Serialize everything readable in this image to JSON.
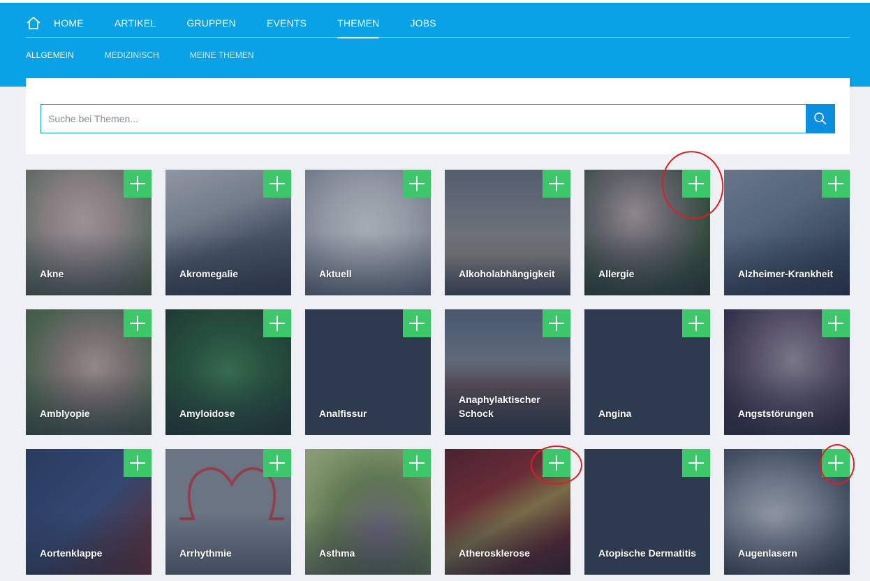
{
  "nav": {
    "home_icon": "home-icon",
    "items": [
      {
        "label": "HOME",
        "active": false
      },
      {
        "label": "ARTIKEL",
        "active": false
      },
      {
        "label": "GRUPPEN",
        "active": false
      },
      {
        "label": "EVENTS",
        "active": false
      },
      {
        "label": "THEMEN",
        "active": true
      },
      {
        "label": "JOBS",
        "active": false
      }
    ]
  },
  "subnav": {
    "items": [
      {
        "label": "ALLGEMEIN",
        "active": true
      },
      {
        "label": "MEDIZINISCH",
        "active": false
      },
      {
        "label": "MEINE THEMEN",
        "active": false
      }
    ]
  },
  "search": {
    "placeholder": "Suche bei Themen...",
    "value": "",
    "button_icon": "search-icon"
  },
  "colors": {
    "accent": "#0aa2e6",
    "add_button": "#3cc86a",
    "tile_dark": "#2e3a4e",
    "annotation": "#e01b22"
  },
  "topics": [
    {
      "label": "Akne",
      "has_image": true
    },
    {
      "label": "Akromegalie",
      "has_image": true
    },
    {
      "label": "Aktuell",
      "has_image": true
    },
    {
      "label": "Alkoholabhängigkeit",
      "has_image": true
    },
    {
      "label": "Allergie",
      "has_image": true
    },
    {
      "label": "Alzheimer-Krankheit",
      "has_image": true
    },
    {
      "label": "Amblyopie",
      "has_image": true
    },
    {
      "label": "Amyloidose",
      "has_image": true
    },
    {
      "label": "Analfissur",
      "has_image": false
    },
    {
      "label": "Anaphylaktischer Schock",
      "has_image": true
    },
    {
      "label": "Angina",
      "has_image": false
    },
    {
      "label": "Angststörungen",
      "has_image": true
    },
    {
      "label": "Aortenklappe",
      "has_image": true
    },
    {
      "label": "Arrhythmie",
      "has_image": true
    },
    {
      "label": "Asthma",
      "has_image": true
    },
    {
      "label": "Atherosklerose",
      "has_image": true
    },
    {
      "label": "Atopische Dermatitis",
      "has_image": false
    },
    {
      "label": "Augenlasern",
      "has_image": true
    }
  ],
  "add_icon": "plus-icon"
}
